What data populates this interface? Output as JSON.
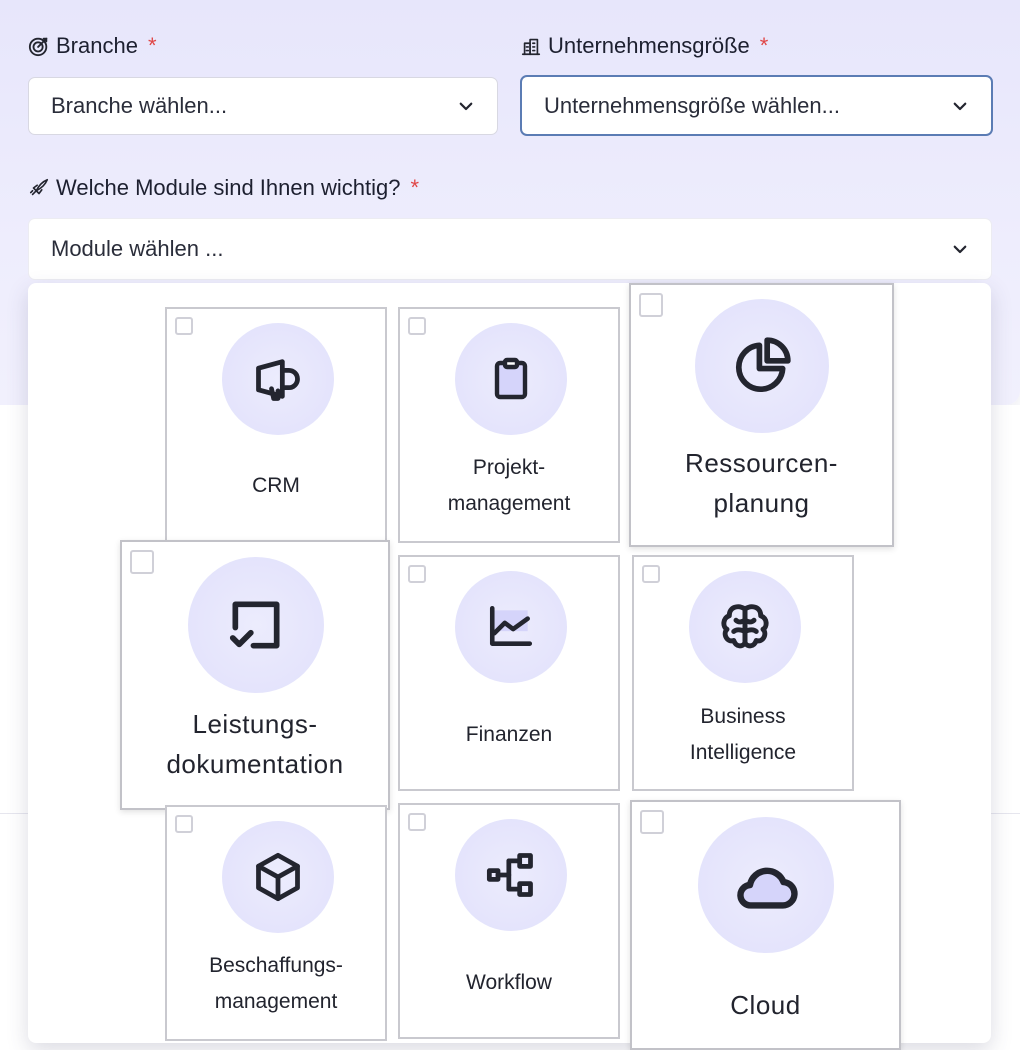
{
  "form": {
    "branche": {
      "label": "Branche",
      "required": "*",
      "placeholder": "Branche wählen..."
    },
    "size": {
      "label": "Unternehmensgröße",
      "required": "*",
      "placeholder": "Unternehmensgröße wählen..."
    },
    "modules": {
      "label": "Welche Module sind Ihnen wichtig?",
      "required": "*",
      "placeholder": "Module wählen ..."
    }
  },
  "module_options": [
    {
      "label_line1": "CRM",
      "label_line2": "",
      "icon": "megaphone-icon",
      "checked": false
    },
    {
      "label_line1": "Projekt-",
      "label_line2": "management",
      "icon": "clipboard-icon",
      "checked": false
    },
    {
      "label_line1": "Ressourcen-",
      "label_line2": "planung",
      "icon": "pie-chart-icon",
      "checked": false
    },
    {
      "label_line1": "Leistungs-",
      "label_line2": "dokumentation",
      "icon": "checkbox-document-icon",
      "checked": false
    },
    {
      "label_line1": "Finanzen",
      "label_line2": "",
      "icon": "line-chart-icon",
      "checked": false
    },
    {
      "label_line1": "Business",
      "label_line2": "Intelligence",
      "icon": "brain-icon",
      "checked": false
    },
    {
      "label_line1": "Beschaffungs-",
      "label_line2": "management",
      "icon": "cube-icon",
      "checked": false
    },
    {
      "label_line1": "Workflow",
      "label_line2": "",
      "icon": "workflow-icon",
      "checked": false
    },
    {
      "label_line1": "Cloud",
      "label_line2": "",
      "icon": "cloud-icon",
      "checked": false
    }
  ],
  "colors": {
    "required": "#e04646",
    "focus_border": "#5b7cb4",
    "icon_circle": "#e4e3fc"
  }
}
